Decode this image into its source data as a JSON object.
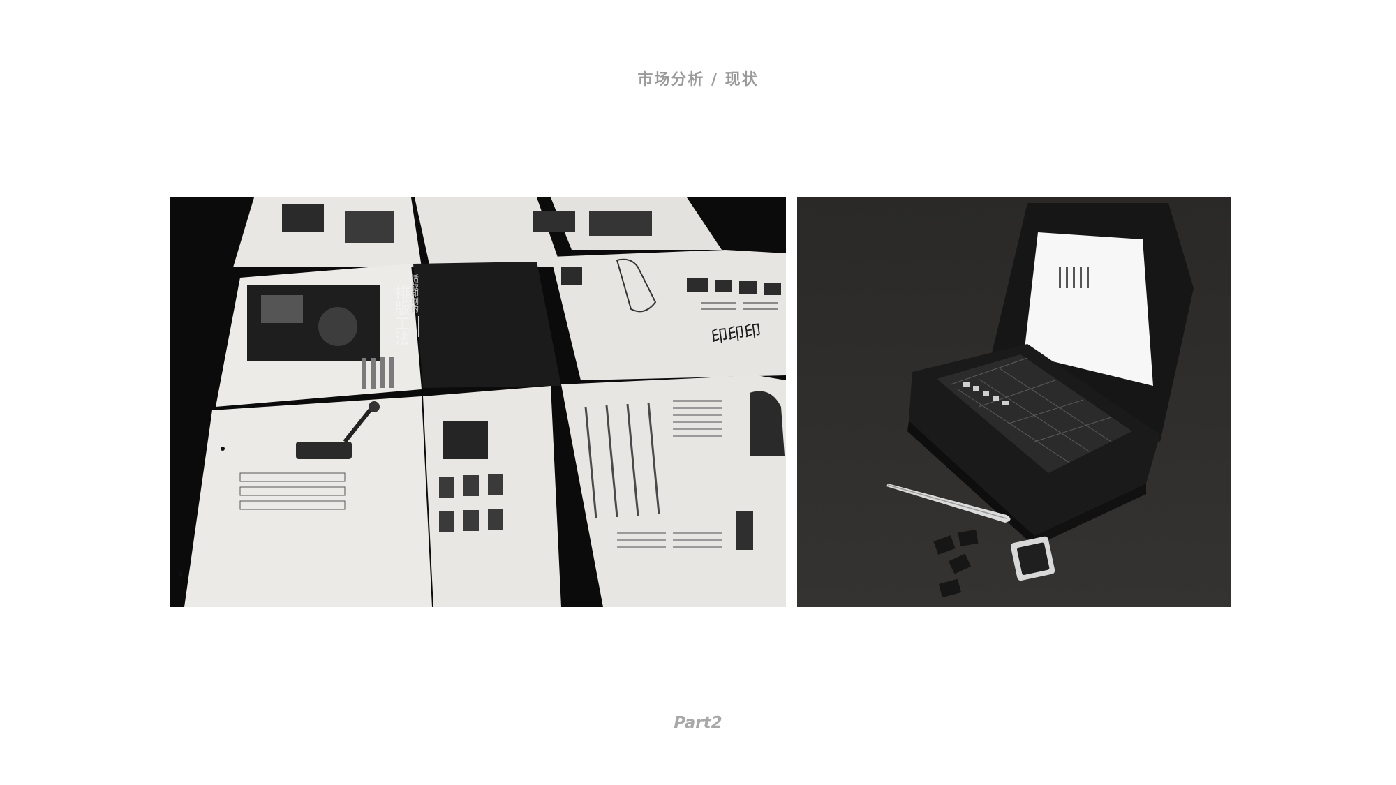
{
  "header": {
    "title": "市场分析 / 现状"
  },
  "left_photo": {
    "booklet_title": "排版工法",
    "booklet_subtitle": "活版印刷的",
    "print_sample": "印印印"
  },
  "footer": {
    "part_label": "Part2"
  }
}
